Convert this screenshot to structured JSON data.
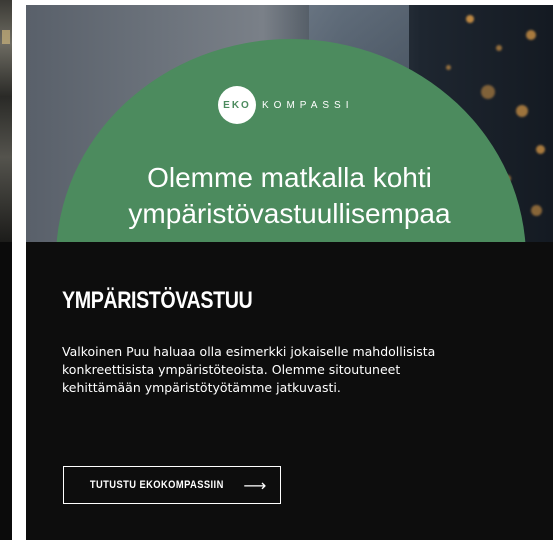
{
  "hero": {
    "logo_badge": "EKO",
    "logo_rest": "KOMPASSI",
    "title_line1": "Olemme matkalla kohti",
    "title_line2": "ympäristövastuullisempaa"
  },
  "section": {
    "title": "YMPÄRISTÖVASTUU",
    "description_line1": "Valkoinen Puu haluaa olla esimerkki jokaiselle mahdollisista",
    "description_line2": "konkreettisista ympäristöteoista. Olemme sitoutuneet",
    "description_line3": "kehittämään ympäristötyötämme jatkuvasti."
  },
  "cta": {
    "label": "TUTUSTU EKOKOMPASSIIN",
    "icon": "arrow-right-icon"
  },
  "colors": {
    "accent_green": "#4c8b5e",
    "card_background": "#0d0d0d",
    "text": "#ffffff"
  }
}
